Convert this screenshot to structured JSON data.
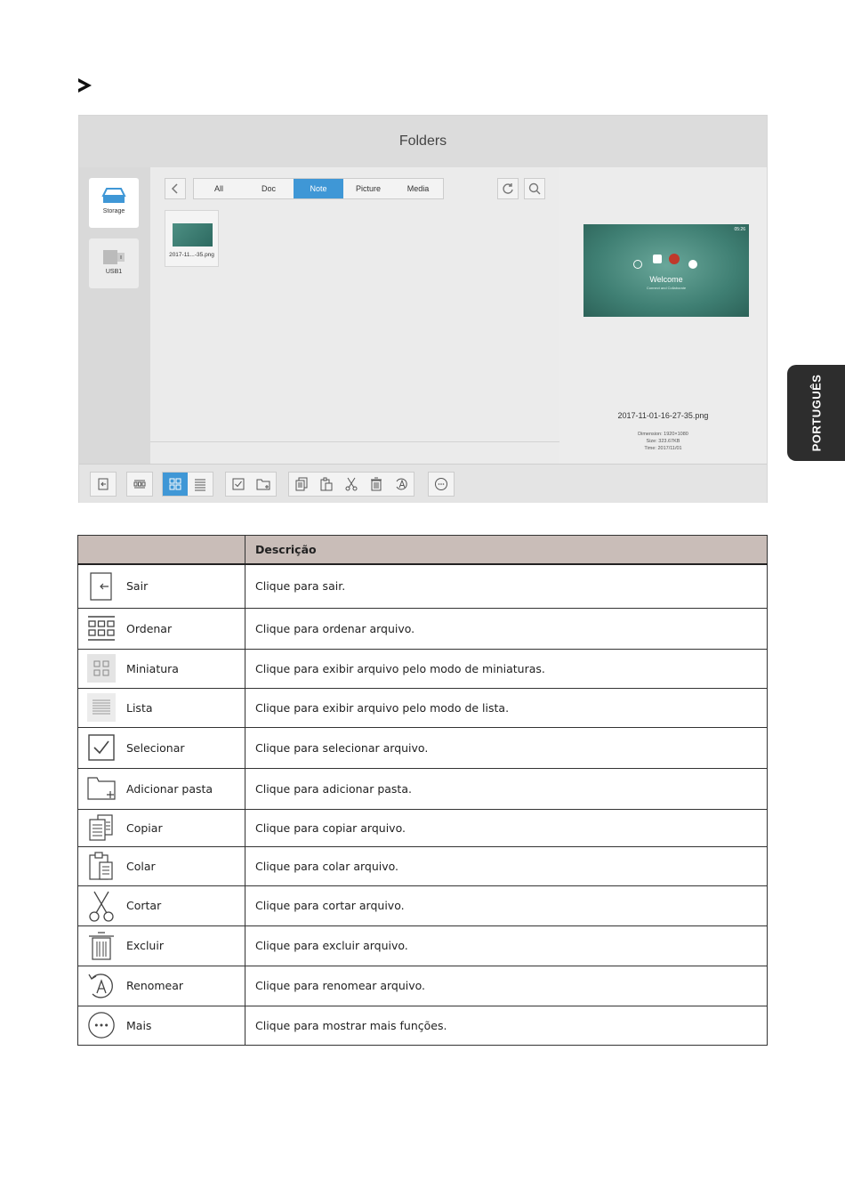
{
  "app": {
    "title": "Folders"
  },
  "sidebar": {
    "drives": [
      {
        "label": "Storage",
        "icon": "storage-icon",
        "active": true
      },
      {
        "label": "USB1",
        "icon": "usb-icon",
        "active": false
      }
    ]
  },
  "filter_tabs": [
    {
      "label": "All",
      "active": false
    },
    {
      "label": "Doc",
      "active": false
    },
    {
      "label": "Note",
      "active": true
    },
    {
      "label": "Picture",
      "active": false
    },
    {
      "label": "Media",
      "active": false
    }
  ],
  "files": [
    {
      "name": "2017-11...-35.png"
    }
  ],
  "preview": {
    "time": "05:26",
    "welcome": "Welcome",
    "welcome_sub": "Connect and Collaborate",
    "file_name": "2017-11-01-16-27-35.png",
    "dimension": "Dimension: 1920×1080",
    "size": "Size: 323.67KB",
    "time_label": "Time: 2017/11/01"
  },
  "side_tab": "PORTUGUÊS",
  "table": {
    "header_col1": "",
    "header_col2": "Descrição",
    "rows": [
      {
        "name": "Sair",
        "icon": "exit-icon",
        "desc": "Clique para sair."
      },
      {
        "name": "Ordenar",
        "icon": "sort-icon",
        "desc": "Clique para ordenar arquivo."
      },
      {
        "name": "Miniatura",
        "icon": "thumbnail-icon",
        "desc": "Clique para exibir arquivo pelo modo de miniaturas."
      },
      {
        "name": "Lista",
        "icon": "list-icon",
        "desc": "Clique para exibir arquivo pelo modo de lista."
      },
      {
        "name": "Selecionar",
        "icon": "select-icon",
        "desc": "Clique para selecionar arquivo."
      },
      {
        "name": "Adicionar pasta",
        "icon": "add-folder-icon",
        "desc": "Clique para adicionar pasta."
      },
      {
        "name": "Copiar",
        "icon": "copy-icon",
        "desc": "Clique para copiar arquivo."
      },
      {
        "name": "Colar",
        "icon": "paste-icon",
        "desc": "Clique para colar arquivo."
      },
      {
        "name": "Cortar",
        "icon": "cut-icon",
        "desc": "Clique para cortar arquivo."
      },
      {
        "name": "Excluir",
        "icon": "delete-icon",
        "desc": "Clique para excluir arquivo."
      },
      {
        "name": "Renomear",
        "icon": "rename-icon",
        "desc": "Clique para renomear arquivo."
      },
      {
        "name": "Mais",
        "icon": "more-icon",
        "desc": "Clique para mostrar mais funções."
      }
    ]
  },
  "colors": {
    "accent": "#3f97d6",
    "table_header": "#c9bdb8",
    "side_tab": "#2d2d2d"
  }
}
